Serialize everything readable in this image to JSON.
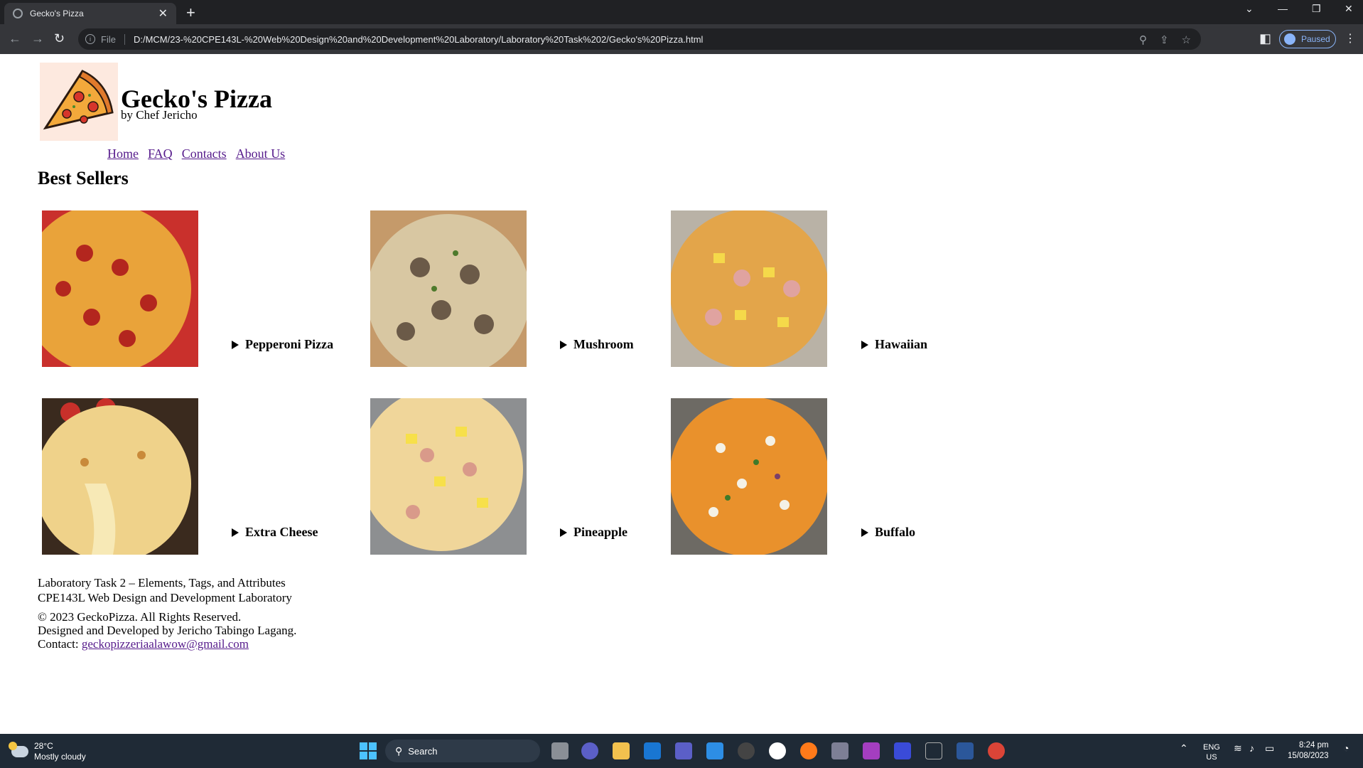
{
  "browser": {
    "tab_title": "Gecko's Pizza",
    "new_tab": "+",
    "close_tab": "✕",
    "scheme": "File",
    "url": "D:/MCM/23-%20CPE143L-%20Web%20Design%20and%20Development%20Laboratory/Laboratory%20Task%202/Gecko's%20Pizza.html",
    "profile_label": "Paused"
  },
  "header": {
    "title": "Gecko's Pizza",
    "subtitle": "by Chef Jericho"
  },
  "nav": {
    "items": [
      {
        "label": "Home"
      },
      {
        "label": "FAQ"
      },
      {
        "label": "Contacts"
      },
      {
        "label": "About Us"
      }
    ]
  },
  "best_sellers": {
    "heading": "Best Sellers",
    "items": [
      {
        "name": "Pepperoni Pizza"
      },
      {
        "name": "Mushroom"
      },
      {
        "name": "Hawaiian"
      },
      {
        "name": "Extra Cheese"
      },
      {
        "name": "Pineapple"
      },
      {
        "name": "Buffalo"
      }
    ]
  },
  "footer": {
    "line1": "Laboratory Task 2 – Elements, Tags, and Attributes",
    "line2": "CPE143L Web Design and Development Laboratory",
    "copyright": "© 2023 GeckoPizza. All Rights Reserved.",
    "credits": "Designed and Developed by Jericho Tabingo Lagang.",
    "contact_label": "Contact: ",
    "contact_email": "geckopizzeriaalawow@gmail.com"
  },
  "taskbar": {
    "weather_temp": "28°C",
    "weather_desc": "Mostly cloudy",
    "search_placeholder": "Search",
    "lang_top": "ENG",
    "lang_bottom": "US",
    "time": "8:24 pm",
    "date": "15/08/2023"
  }
}
